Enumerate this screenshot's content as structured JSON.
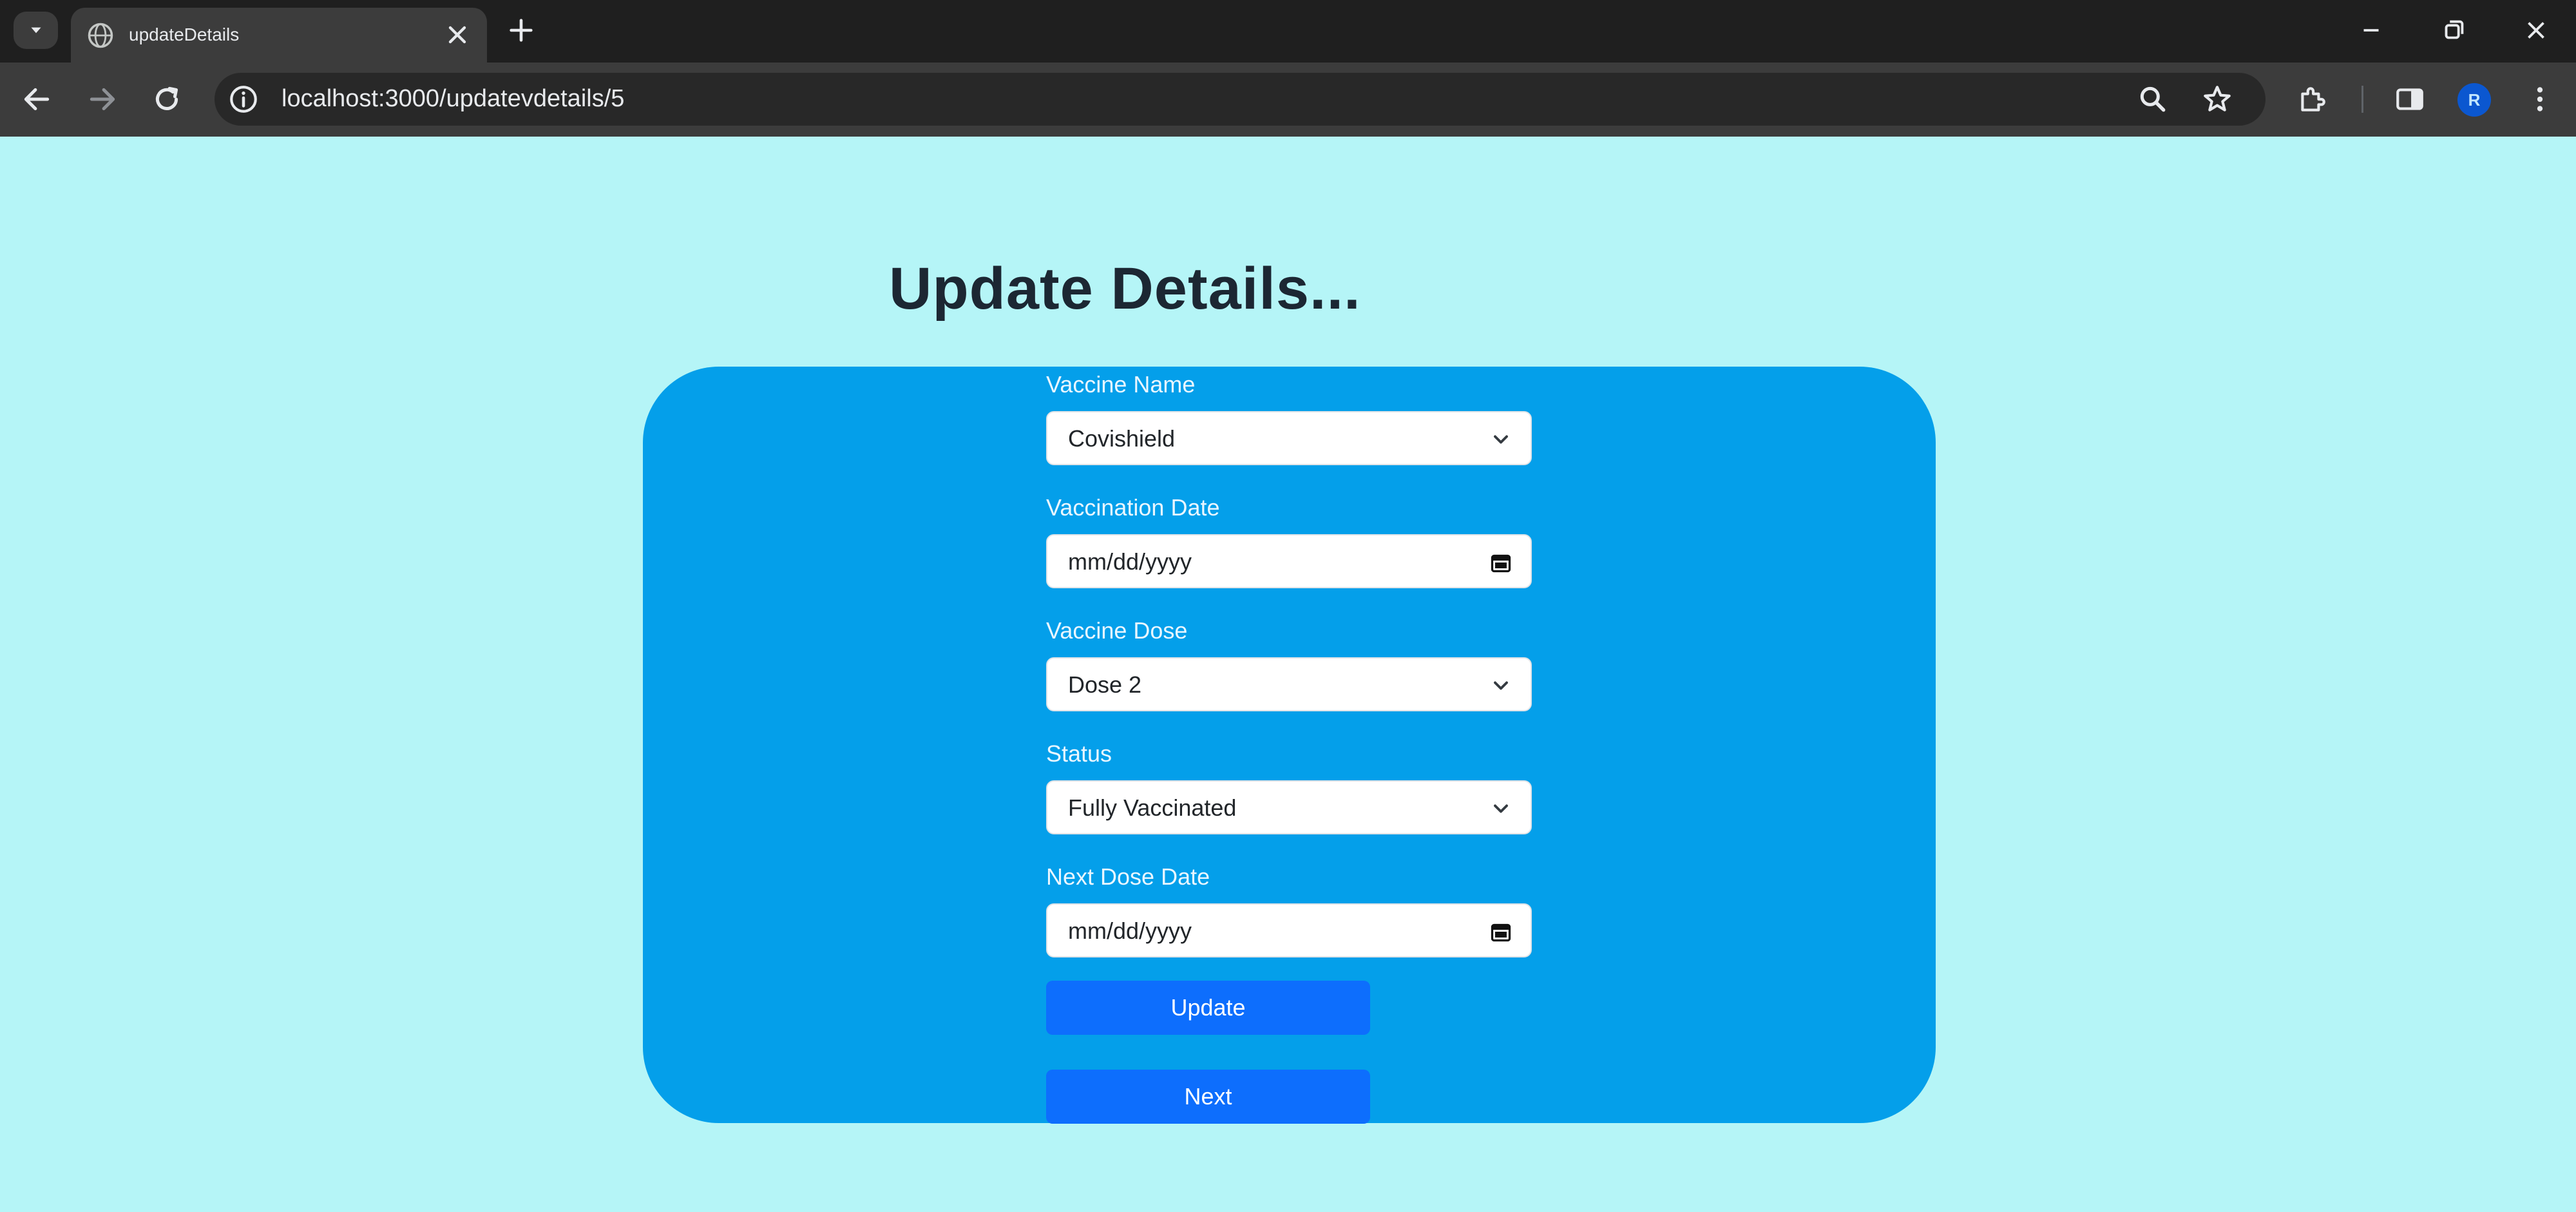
{
  "browser": {
    "tab_title": "updateDetails",
    "url": "localhost:3000/updatevdetails/5",
    "profile_initial": "R"
  },
  "page": {
    "title": "Update Details...",
    "fields": [
      {
        "label": "Vaccine Name",
        "value": "Covishield",
        "type": "select",
        "icon": "chevron-down-icon"
      },
      {
        "label": "Vaccination Date",
        "value": "mm/dd/yyyy",
        "type": "date",
        "icon": "calendar-icon"
      },
      {
        "label": "Vaccine Dose",
        "value": "Dose 2",
        "type": "select",
        "icon": "chevron-down-icon"
      },
      {
        "label": "Status",
        "value": "Fully Vaccinated",
        "type": "select",
        "icon": "chevron-down-icon"
      },
      {
        "label": "Next Dose Date",
        "value": "mm/dd/yyyy",
        "type": "date",
        "icon": "calendar-icon"
      }
    ],
    "update_button": "Update",
    "next_button": "Next"
  },
  "colors": {
    "page_background": "#b5f5f7",
    "card_background": "#049fea",
    "button_primary": "#0d6efd"
  }
}
